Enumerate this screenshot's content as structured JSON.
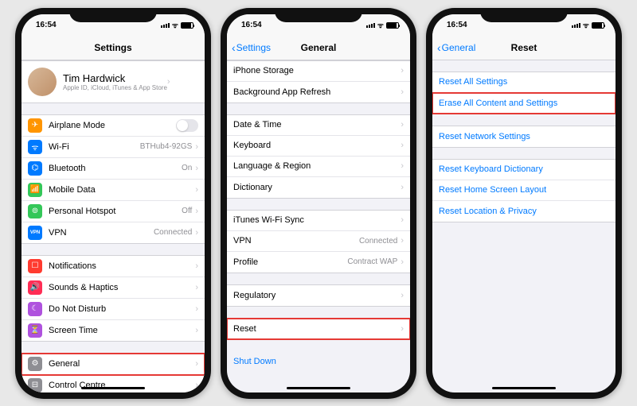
{
  "status": {
    "time": "16:54"
  },
  "screen1": {
    "title": "Settings",
    "profile": {
      "name": "Tim Hardwick",
      "sub": "Apple ID, iCloud, iTunes & App Store"
    },
    "g1": [
      {
        "icon": "airplane-icon",
        "label": "Airplane Mode",
        "toggle": true,
        "bg": "bg-orange",
        "glyph": "✈"
      },
      {
        "icon": "wifi-icon",
        "label": "Wi-Fi",
        "value": "BTHub4-92GS",
        "bg": "bg-blue",
        "glyph": "ᯤ"
      },
      {
        "icon": "bluetooth-icon",
        "label": "Bluetooth",
        "value": "On",
        "bg": "bg-blue",
        "glyph": "⌬"
      },
      {
        "icon": "mobiledata-icon",
        "label": "Mobile Data",
        "bg": "bg-green",
        "glyph": "📶"
      },
      {
        "icon": "hotspot-icon",
        "label": "Personal Hotspot",
        "value": "Off",
        "bg": "bg-green",
        "glyph": "⊚"
      },
      {
        "icon": "vpn-icon",
        "label": "VPN",
        "value": "Connected",
        "bg": "bg-blue",
        "glyph": "VPN",
        "vpnStyle": true
      }
    ],
    "g2": [
      {
        "icon": "notifications-icon",
        "label": "Notifications",
        "bg": "bg-red",
        "glyph": "☐"
      },
      {
        "icon": "sounds-icon",
        "label": "Sounds & Haptics",
        "bg": "bg-pink",
        "glyph": "🔊"
      },
      {
        "icon": "dnd-icon",
        "label": "Do Not Disturb",
        "bg": "bg-purple",
        "glyph": "☾"
      },
      {
        "icon": "screentime-icon",
        "label": "Screen Time",
        "bg": "bg-purple",
        "glyph": "⏳"
      }
    ],
    "g3": [
      {
        "icon": "general-icon",
        "label": "General",
        "bg": "bg-gray",
        "glyph": "⚙",
        "highlight": true
      },
      {
        "icon": "controlcentre-icon",
        "label": "Control Centre",
        "bg": "bg-gray",
        "glyph": "⊟"
      }
    ]
  },
  "screen2": {
    "back": "Settings",
    "title": "General",
    "g1": [
      {
        "label": "iPhone Storage"
      },
      {
        "label": "Background App Refresh"
      }
    ],
    "g2": [
      {
        "label": "Date & Time"
      },
      {
        "label": "Keyboard"
      },
      {
        "label": "Language & Region"
      },
      {
        "label": "Dictionary"
      }
    ],
    "g3": [
      {
        "label": "iTunes Wi-Fi Sync"
      },
      {
        "label": "VPN",
        "value": "Connected"
      },
      {
        "label": "Profile",
        "value": "Contract WAP"
      }
    ],
    "g4": [
      {
        "label": "Regulatory"
      }
    ],
    "g5": [
      {
        "label": "Reset",
        "highlight": true
      }
    ],
    "g6": [
      {
        "label": "Shut Down",
        "link": true
      }
    ]
  },
  "screen3": {
    "back": "General",
    "title": "Reset",
    "g1": [
      {
        "label": "Reset All Settings",
        "link": true
      },
      {
        "label": "Erase All Content and Settings",
        "link": true,
        "highlight": true
      }
    ],
    "g2": [
      {
        "label": "Reset Network Settings",
        "link": true
      }
    ],
    "g3": [
      {
        "label": "Reset Keyboard Dictionary",
        "link": true
      },
      {
        "label": "Reset Home Screen Layout",
        "link": true
      },
      {
        "label": "Reset Location & Privacy",
        "link": true
      }
    ]
  }
}
